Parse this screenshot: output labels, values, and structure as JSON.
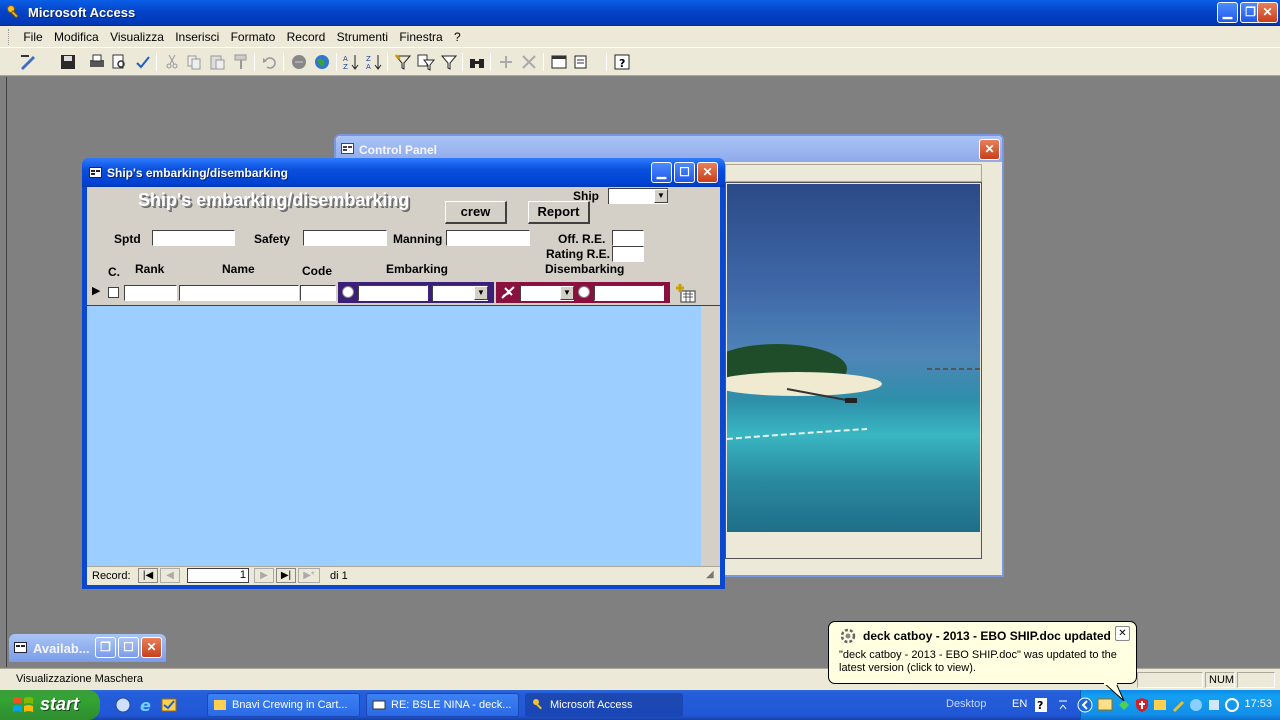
{
  "app": {
    "title": "Microsoft Access"
  },
  "menu": [
    "File",
    "Modifica",
    "Visualizza",
    "Inserisci",
    "Formato",
    "Record",
    "Strumenti",
    "Finestra",
    "?"
  ],
  "control_panel": {
    "title": "Control Panel"
  },
  "form": {
    "window_title": "Ship's embarking/disembarking",
    "heading": "Ship's embarking/disembarking",
    "crew_button": "crew",
    "report_button": "Report",
    "ship_label": "Ship",
    "sptd_label": "Sptd",
    "safety_label": "Safety",
    "manning_label": "Manning",
    "off_re_label": "Off. R.E.",
    "rating_re_label": "Rating R.E.",
    "columns": {
      "c": "C.",
      "rank": "Rank",
      "name": "Name",
      "code": "Code",
      "embarking": "Embarking",
      "disembarking": "Disembarking"
    },
    "nav": {
      "label": "Record:",
      "current": "1",
      "total": "di 1"
    }
  },
  "min_window": {
    "title": "Availab..."
  },
  "status": {
    "text": "Visualizzazione Maschera",
    "num": "NUM"
  },
  "taskbar": {
    "start": "start",
    "tasks": [
      "Bnavi Crewing in Cart...",
      "RE: BSLE NINA - deck...",
      "Microsoft Access"
    ],
    "desktop": "Desktop",
    "lang": "EN",
    "clock": "17:53"
  },
  "balloon": {
    "title": "deck catboy - 2013 - EBO SHIP.doc updated",
    "body": "\"deck catboy - 2013 - EBO SHIP.doc\" was updated to the latest version (click to view)."
  }
}
